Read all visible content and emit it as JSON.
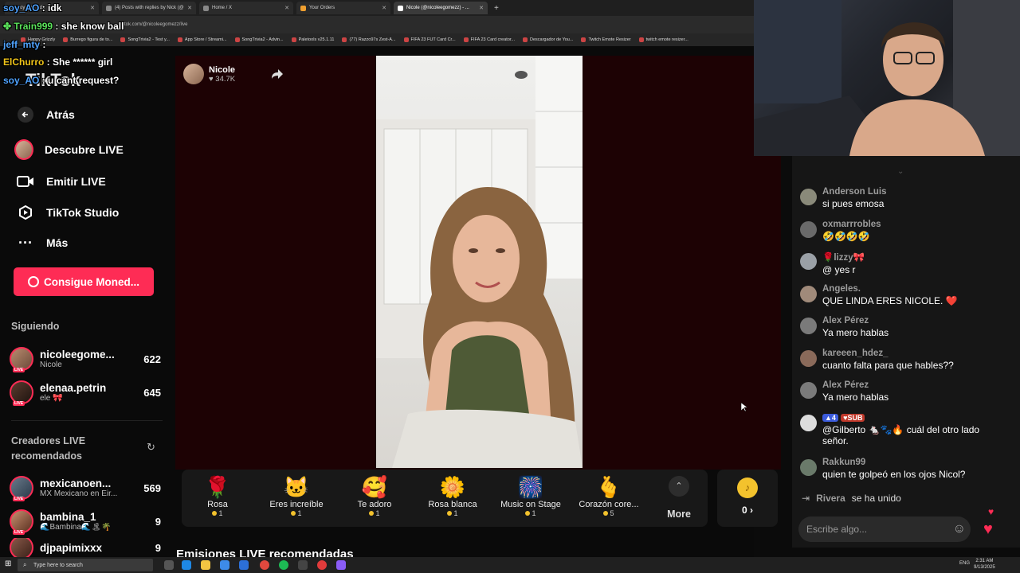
{
  "browser": {
    "tabs": [
      {
        "label": "soy_AO : idk"
      },
      {
        "label": "(4) Posts with replies by Nick (@"
      },
      {
        "label": "Home / X"
      },
      {
        "label": "Your Orders"
      },
      {
        "label": "Nicole (@nicoleegomezz) - ..."
      }
    ],
    "address": "tiktok.com/@nicoleegomezz/live",
    "bookmarks": [
      "Happy Grizzly",
      "Burrego figura de to...",
      "SongTrivia2 - Test y...",
      "App Store / Streami...",
      "SongTrivia2 - Advin...",
      "Paletools v25.1.11",
      "(77) Razzo97s Zest-A...",
      "FIFA 23 FUT Card Cr...",
      "FIFA 23 Card creator...",
      "Descargador de You...",
      "Twitch Emote Resizer",
      "twitch emote resizer..."
    ]
  },
  "overlay_chat": [
    {
      "user": "soy_AO",
      "text": " : idk",
      "color": "#4fa3ff"
    },
    {
      "user": "Train999",
      "text": " : she know ball",
      "color": "#5be35b"
    },
    {
      "user": "jeff_mty",
      "text": " :",
      "color": "#4fa3ff"
    },
    {
      "user": "ElChurro",
      "text": " : She ****** girl",
      "color": "#f0c419"
    },
    {
      "user": "soy_AO",
      "text": " : u cant request?",
      "color": "#4fa3ff"
    }
  ],
  "brand": "TikTok",
  "sidebar": {
    "back": "Atrás",
    "nav": [
      {
        "label": "Descubre LIVE",
        "icon": "live-avatar-icon"
      },
      {
        "label": "Emitir LIVE",
        "icon": "video-camera-icon"
      },
      {
        "label": "TikTok Studio",
        "icon": "studio-icon"
      },
      {
        "label": "Más",
        "icon": "more-dots-icon"
      }
    ],
    "coins_button": "Consigue Moned...",
    "following_title": "Siguiendo",
    "following": [
      {
        "name": "nicoleegome...",
        "sub": "Nicole",
        "count": "622"
      },
      {
        "name": "elenaa.petrin",
        "sub": "ele 🎀",
        "count": "645"
      }
    ],
    "creators_title": "Creadores LIVE recomendados",
    "creators": [
      {
        "name": "mexicanoen...",
        "sub": "MX Mexicano en Éir...",
        "count": "569"
      },
      {
        "name": "bambina_1",
        "sub": "🌊Bambina🌊🏝🌴",
        "count": "9"
      },
      {
        "name": "djpapimixxx",
        "sub": "",
        "count": "9"
      }
    ],
    "live_badge": "LIVE"
  },
  "stream": {
    "host_name": "Nicole",
    "host_likes": "34.7K",
    "recommended_title": "Emisiones LIVE recomendadas"
  },
  "gifts": [
    {
      "name": "Rosa",
      "price": "1",
      "icon": "🌹"
    },
    {
      "name": "Eres increíble",
      "price": "1",
      "icon": "🐱"
    },
    {
      "name": "Te adoro",
      "price": "1",
      "icon": "🥰"
    },
    {
      "name": "Rosa blanca",
      "price": "1",
      "icon": "🌼"
    },
    {
      "name": "Music on Stage",
      "price": "1",
      "icon": "🎆"
    },
    {
      "name": "Corazón core...",
      "price": "5",
      "icon": "🫰"
    }
  ],
  "gifts_more": "More",
  "coins": {
    "value": "0 ›"
  },
  "chat": [
    {
      "user": "Anderson Luis",
      "text": "si pues emosa"
    },
    {
      "user": "oxmarrrobles",
      "text": "🤣🤣🤣🤣"
    },
    {
      "user": "🌹lizzy🎀",
      "text": "@ yes r"
    },
    {
      "user": "Angeles.",
      "text": "QUE LINDA ERES NICOLE. ❤️"
    },
    {
      "user": "Alex Pérez",
      "text": "Ya mero hablas"
    },
    {
      "user": "kareeen_hdez_",
      "text": "cuanto falta para que hables??"
    },
    {
      "user": "Alex Pérez",
      "text": "Ya mero hablas"
    },
    {
      "user": "4 SUB",
      "text": "@Gilberto 🐁🐾🔥 cuál del otro lado señor."
    },
    {
      "user": "Rakkun99",
      "text": "quien te golpeó en los ojos Nicol?"
    }
  ],
  "chat_join": {
    "user": "Rivera",
    "text": "se ha unido"
  },
  "chat_placeholder": "Escribe algo...",
  "taskbar": {
    "search": "Type here to search",
    "time": "2:31 AM",
    "date": "9/13/2025",
    "lang": "ENG"
  }
}
